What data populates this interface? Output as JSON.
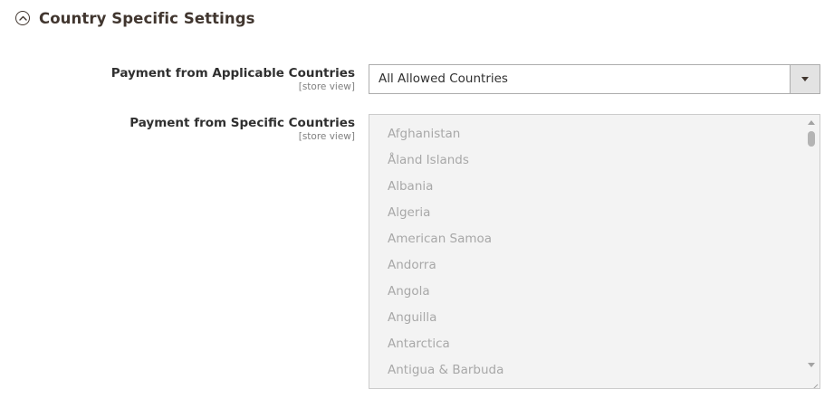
{
  "section": {
    "title": "Country Specific Settings",
    "expanded": true
  },
  "fields": {
    "applicable_countries": {
      "label": "Payment from Applicable Countries",
      "scope": "[store view]",
      "selected": "All Allowed Countries"
    },
    "specific_countries": {
      "label": "Payment from Specific Countries",
      "scope": "[store view]",
      "disabled": true,
      "options": [
        "Afghanistan",
        "Åland Islands",
        "Albania",
        "Algeria",
        "American Samoa",
        "Andorra",
        "Angola",
        "Anguilla",
        "Antarctica",
        "Antigua & Barbuda"
      ]
    }
  },
  "colors": {
    "heading": "#41362f",
    "label": "#303030",
    "scope": "#808080",
    "disabled_bg": "#f3f3f3",
    "disabled_text": "#a8a8a8",
    "border": "#adadad"
  },
  "icons": {
    "section_toggle": "chevron-up-circle-icon",
    "select_arrow": "caret-down-icon",
    "scroll_up": "caret-up-icon",
    "scroll_down": "caret-down-icon",
    "resize": "resize-grip-icon"
  }
}
